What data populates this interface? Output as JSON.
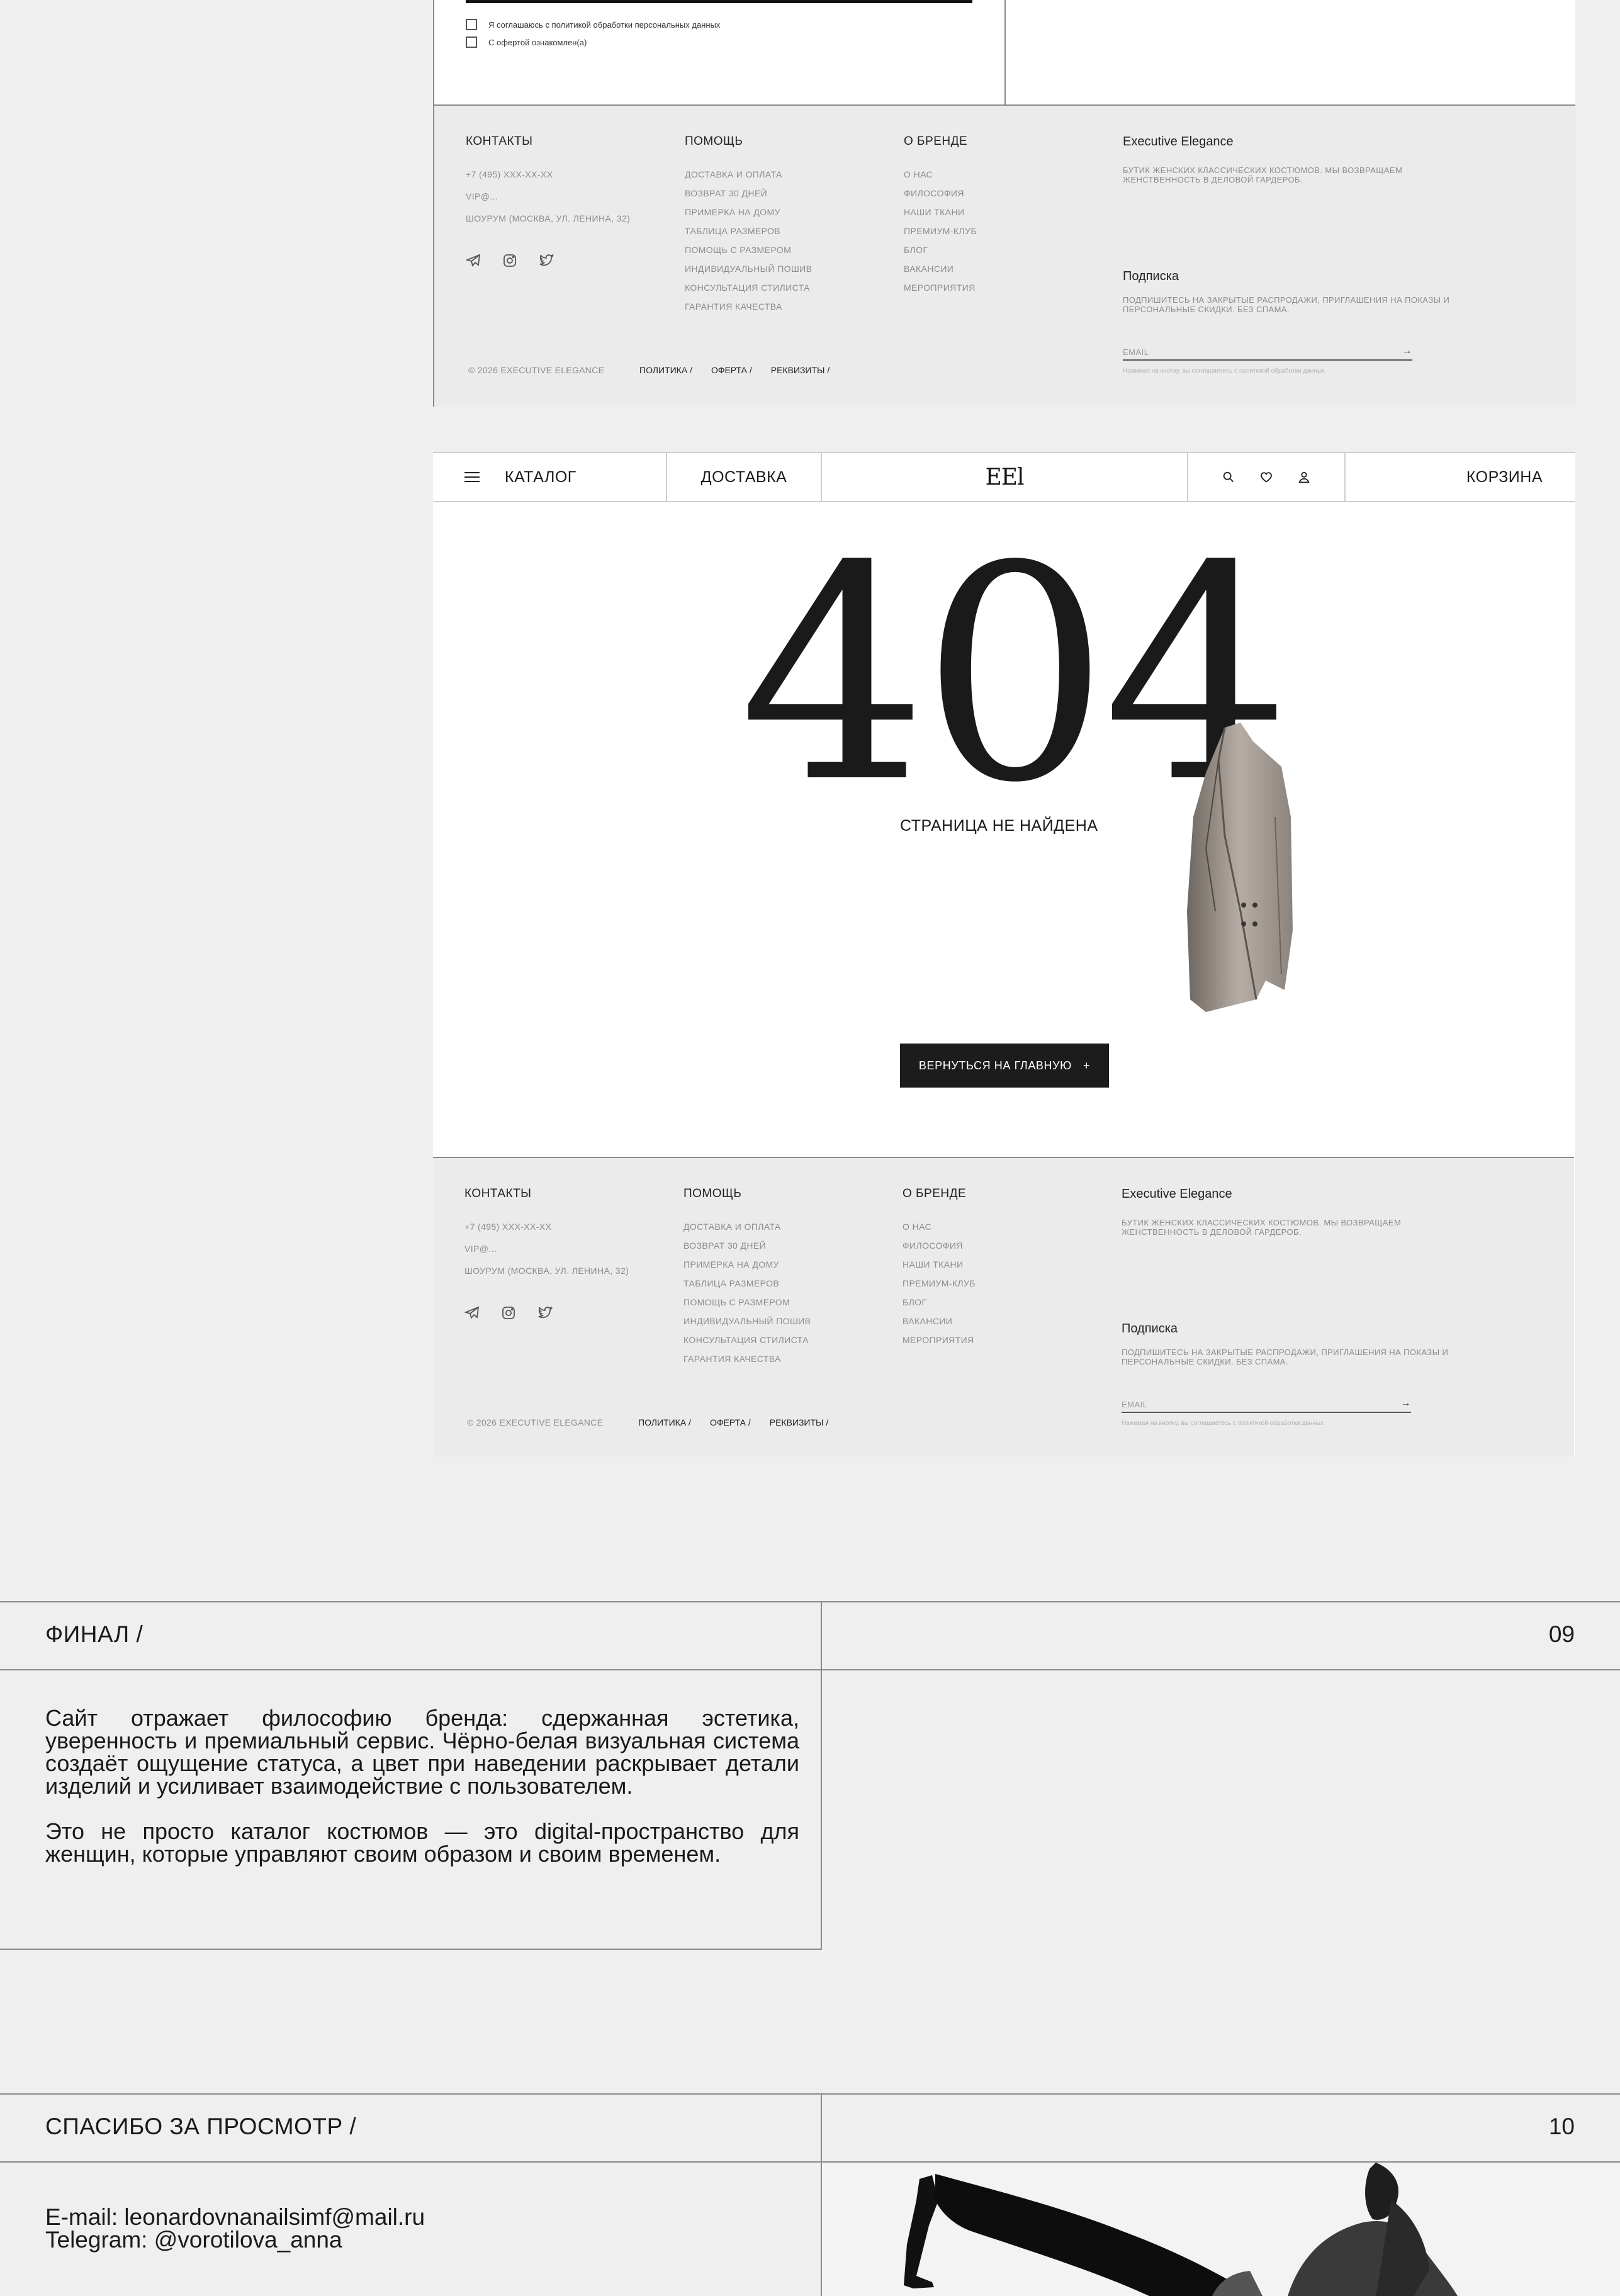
{
  "top_form": {
    "consent_privacy": "Я соглашаюсь с политикой обработки персональных данных",
    "consent_offer": "С офертой ознакомлен(а)"
  },
  "footer": {
    "contacts": {
      "heading": "КОНТАКТЫ",
      "phone": "+7 (495) XXX-XX-XX",
      "email": "VIP@...",
      "showroom": "ШОУРУМ (МОСКВА, УЛ. ЛЕНИНА, 32)",
      "social_icons": [
        "telegram-icon",
        "instagram-icon",
        "twitter-icon"
      ]
    },
    "help": {
      "heading": "ПОМОЩЬ",
      "links": [
        "ДОСТАВКА И ОПЛАТА",
        "ВОЗВРАТ 30 ДНЕЙ",
        "ПРИМЕРКА НА ДОМУ",
        "ТАБЛИЦА РАЗМЕРОВ",
        "ПОМОЩЬ С РАЗМЕРОМ",
        "ИНДИВИДУАЛЬНЫЙ ПОШИВ",
        "КОНСУЛЬТАЦИЯ СТИЛИСТА",
        "ГАРАНТИЯ КАЧЕСТВА"
      ]
    },
    "about": {
      "heading": "О БРЕНДЕ",
      "links": [
        "О НАС",
        "ФИЛОСОФИЯ",
        "НАШИ ТКАНИ",
        "ПРЕМИУМ-КЛУБ",
        "БЛОГ",
        "ВАКАНСИИ",
        "МЕРОПРИЯТИЯ"
      ]
    },
    "brand": {
      "title": "Executive Elegance",
      "description": "БУТИК ЖЕНСКИХ КЛАССИЧЕСКИХ КОСТЮМОВ. Мы ВОЗВРАЩАЕМ ЖЕНСТВЕННОСТЬ В ДЕЛОВОЙ ГАРДЕРОБ."
    },
    "subscribe": {
      "title": "Подписка",
      "description": "ПОДПИШИТЕСЬ НА ЗАКРЫТЫЕ РАСПРОДАЖИ, ПРИГЛАШЕНИЯ НА ПОКАЗЫ И ПЕРСОНАЛЬНЫЕ СКИДКИ. БЕЗ СПАМА.",
      "email_placeholder": "EMAIL",
      "note": "Нажимая на кнопку, вы соглашаетесь с политикой обработки данных"
    },
    "copyright": "© 2026 EXECUTIVE ELEGANCE",
    "legal": [
      "ПОЛИТИКА /",
      "ОФЕРТА /",
      "РЕКВИЗИТЫ /"
    ]
  },
  "nav": {
    "catalog": "КАТАЛОГ",
    "delivery": "ДОСТАВКА",
    "logo": "EEl",
    "cart": "КОРЗИНА",
    "icons": [
      "search-icon",
      "heart-icon",
      "user-icon"
    ]
  },
  "error_page": {
    "code": "404",
    "message": "СТРАНИЦА НЕ НАЙДЕНА",
    "button": "ВЕРНУТЬСЯ НА ГЛАВНУЮ",
    "button_icon": "+"
  },
  "final_section": {
    "title": "ФИНАЛ /",
    "number": "09",
    "paragraph1": "Сайт отражает философию бренда: сдержанная эстетика, уверенность и премиальный сервис. Чёрно-белая визуальная система создаёт ощущение статуса, а цвет при наведении раскрывает детали изделий и усиливает взаимодействие с пользователем.",
    "paragraph2": "Это не просто каталог костюмов — это digital-пространство для женщин, которые управляют своим образом и своим временем."
  },
  "thanks_section": {
    "title": "СПАСИБО ЗА ПРОСМОТР /",
    "number": "10",
    "email_line": "E-mail: leonardovnanailsimf@mail.ru",
    "telegram_line": "Telegram: @vorotilova_anna"
  }
}
